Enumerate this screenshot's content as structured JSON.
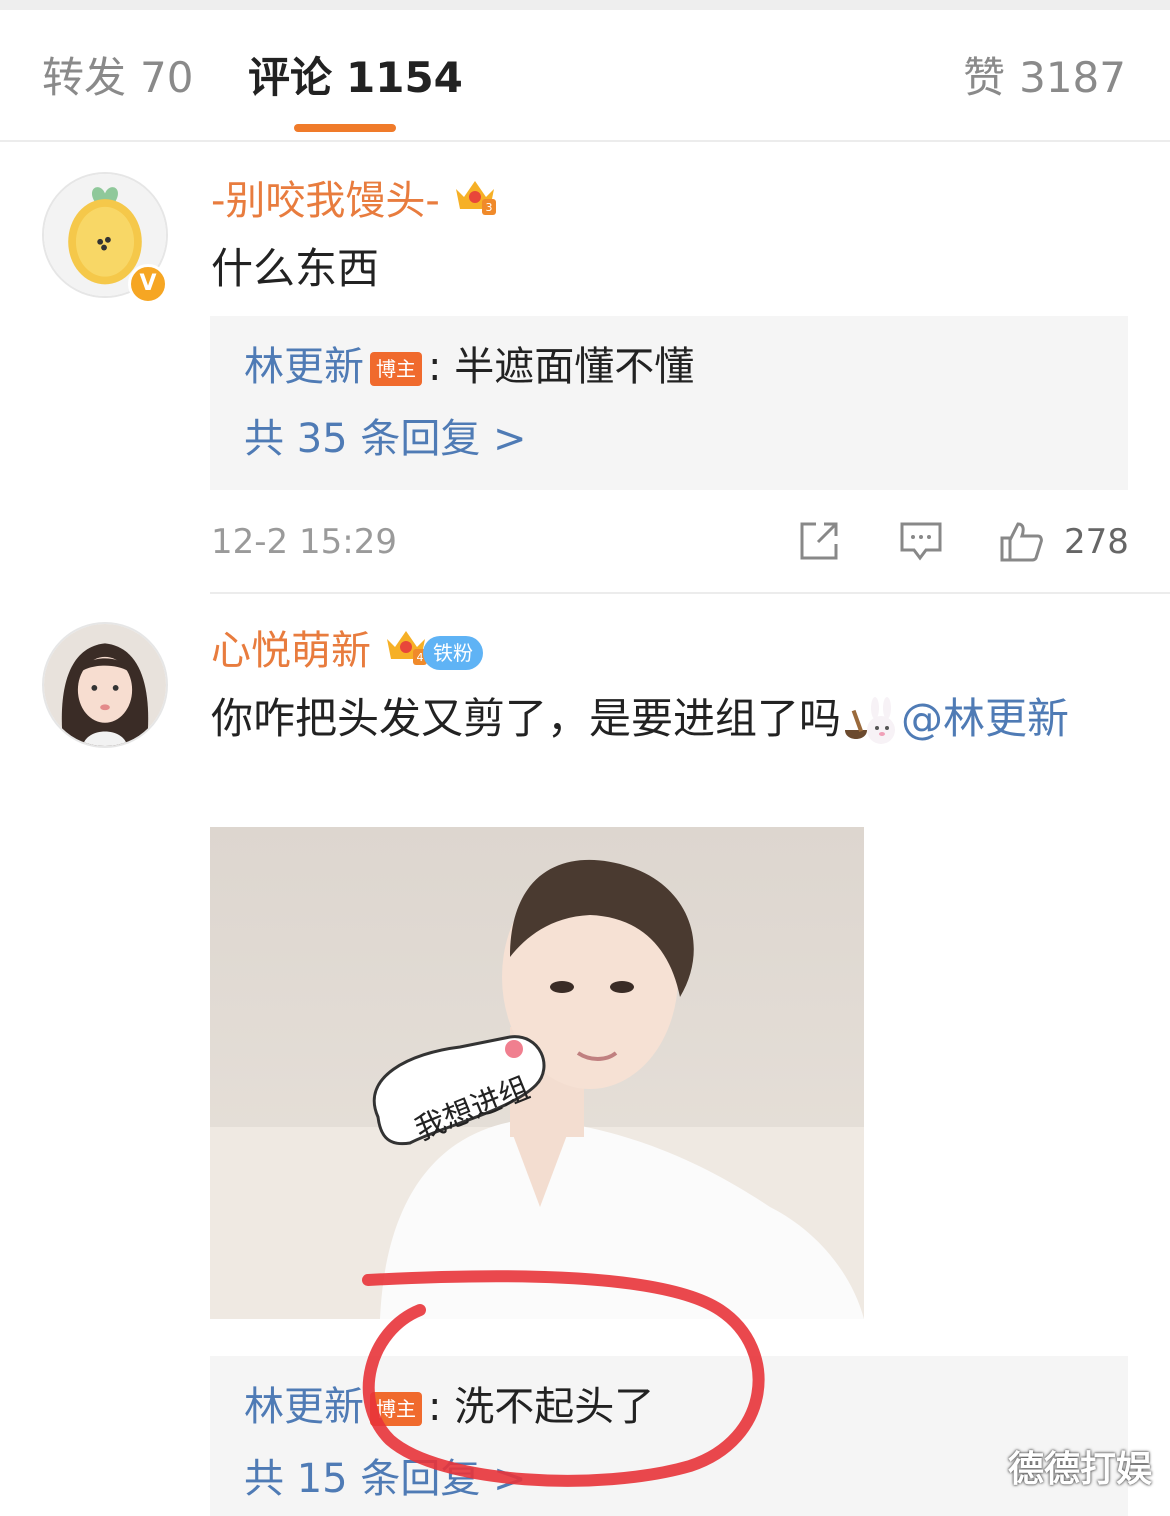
{
  "tabs": {
    "repost": {
      "label": "转发",
      "count": "70"
    },
    "comments": {
      "label": "评论",
      "count": "1154"
    },
    "likes": {
      "label": "赞",
      "count": "3187"
    }
  },
  "comments": [
    {
      "username": "-别咬我馒头-",
      "crown_level": "3",
      "text": "什么东西",
      "reply": {
        "author": "林更新",
        "host_tag": "博主",
        "separator": ":",
        "text": "半遮面懂不懂"
      },
      "reply_count_label": "共 35 条回复 >",
      "timestamp": "12-2 15:29",
      "like_count": "278",
      "verified_mark": "V"
    },
    {
      "username": "心悦萌新",
      "crown_level": "4",
      "fan_badge": "铁粉",
      "text_before": "你咋把头发又剪了，是要进组了吗",
      "mention": "@林更新",
      "image_sticker_text": "我想进组",
      "reply": {
        "author": "林更新",
        "host_tag": "博主",
        "separator": ":",
        "text": "洗不起头了"
      },
      "reply_count_label": "共 15 条回复 >"
    }
  ],
  "watermark": "德德打娱",
  "colors": {
    "accent": "#f07b2a",
    "username": "#e87c3e",
    "link": "#4f7bb5",
    "host_tag": "#f06a2d",
    "annotation": "#e8343a"
  }
}
